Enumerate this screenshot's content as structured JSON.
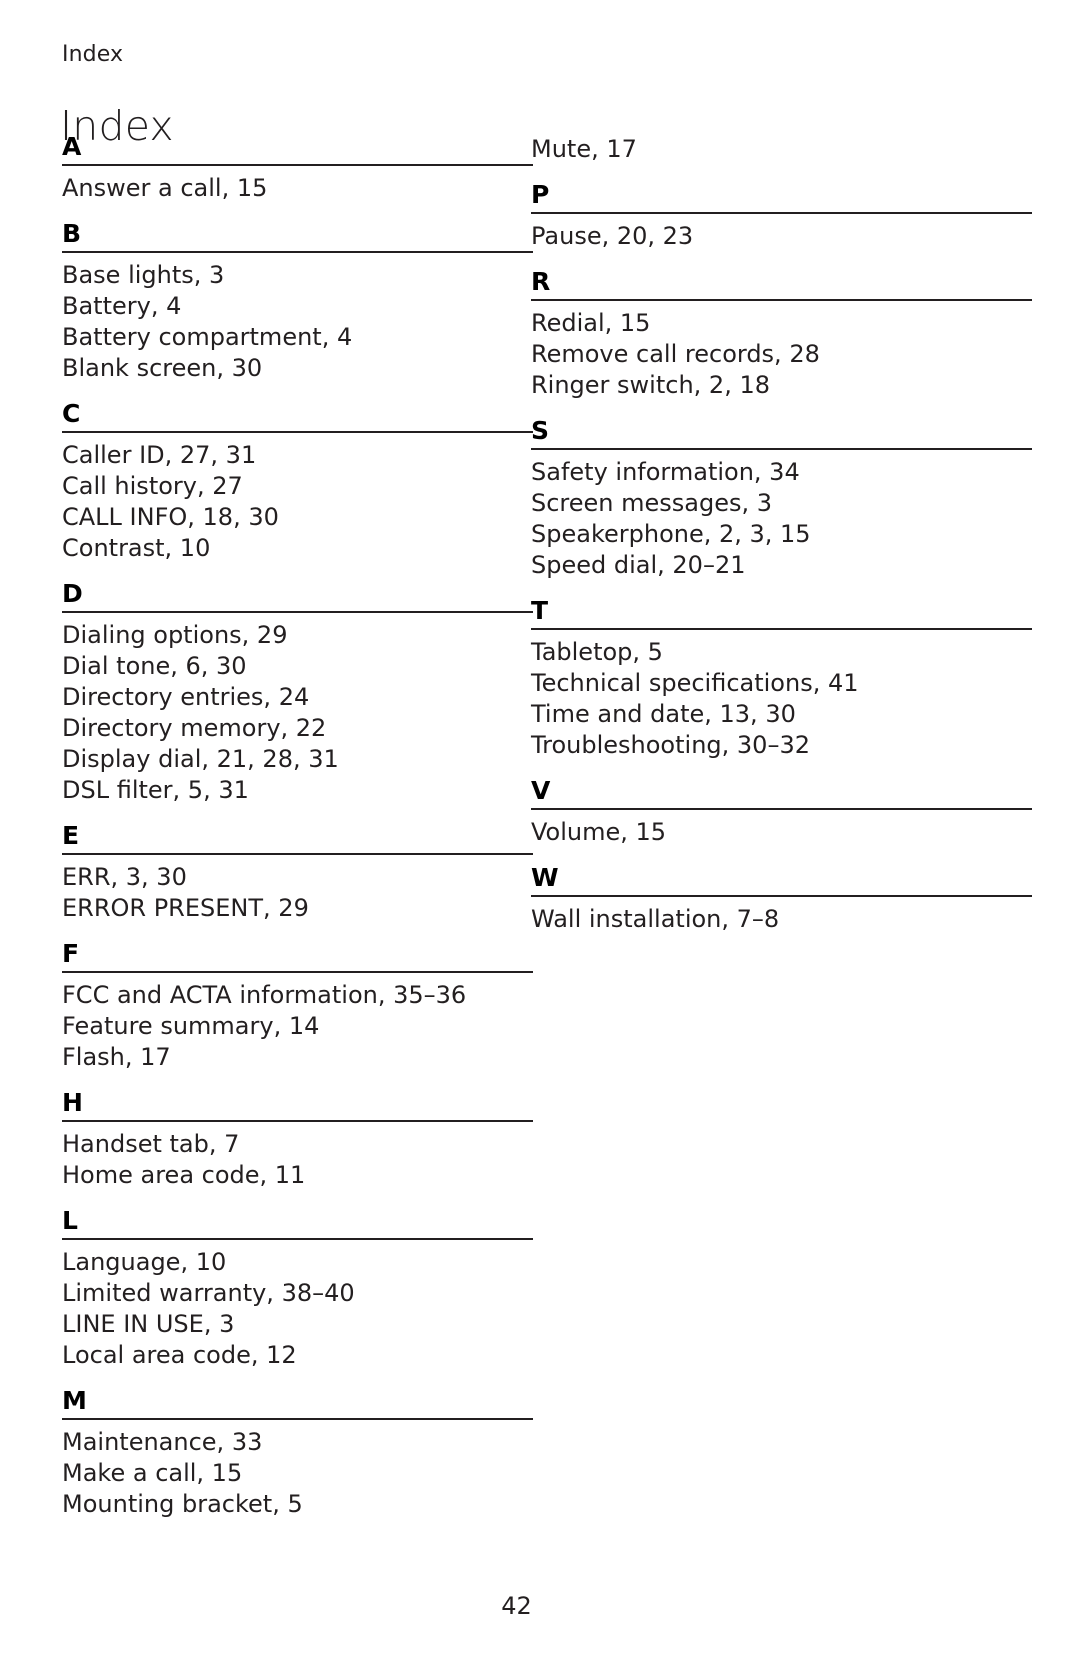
{
  "document": {
    "running_header": "Index",
    "title": "Index",
    "page_number": "42",
    "rule_color": "#231f20",
    "text_color": "#231f20"
  },
  "columns": [
    {
      "name": "left-column",
      "continuation_entries": [],
      "groups": [
        {
          "letter": "A",
          "entries": [
            "Answer a call, 15"
          ]
        },
        {
          "letter": "B",
          "entries": [
            "Base lights, 3",
            "Battery, 4",
            "Battery compartment, 4",
            "Blank screen, 30"
          ]
        },
        {
          "letter": "C",
          "entries": [
            "Caller ID, 27, 31",
            "Call history, 27",
            "CALL INFO, 18, 30",
            "Contrast, 10"
          ]
        },
        {
          "letter": "D",
          "entries": [
            "Dialing options, 29",
            "Dial tone, 6, 30",
            "Directory entries, 24",
            "Directory memory, 22",
            "Display dial, 21, 28, 31",
            "DSL filter, 5, 31"
          ]
        },
        {
          "letter": "E",
          "entries": [
            "ERR, 3, 30",
            "ERROR PRESENT, 29"
          ]
        },
        {
          "letter": "F",
          "entries": [
            "FCC and ACTA information, 35–36",
            "Feature summary, 14",
            "Flash, 17"
          ]
        },
        {
          "letter": "H",
          "entries": [
            "Handset tab, 7",
            "Home area code, 11"
          ]
        },
        {
          "letter": "L",
          "entries": [
            "Language, 10",
            "Limited warranty, 38–40",
            "LINE IN USE, 3",
            "Local area code, 12"
          ]
        },
        {
          "letter": "M",
          "entries": [
            "Maintenance, 33",
            "Make a call, 15",
            "Mounting bracket, 5"
          ]
        }
      ]
    },
    {
      "name": "right-column",
      "continuation_entries": [
        "Mute, 17"
      ],
      "groups": [
        {
          "letter": "P",
          "entries": [
            "Pause, 20, 23"
          ]
        },
        {
          "letter": "R",
          "entries": [
            "Redial, 15",
            "Remove call records, 28",
            "Ringer switch, 2, 18"
          ]
        },
        {
          "letter": "S",
          "entries": [
            "Safety information, 34",
            "Screen messages, 3",
            "Speakerphone, 2, 3, 15",
            "Speed dial, 20–21"
          ]
        },
        {
          "letter": "T",
          "entries": [
            "Tabletop, 5",
            "Technical specifications, 41",
            "Time and date, 13, 30",
            "Troubleshooting, 30–32"
          ]
        },
        {
          "letter": "V",
          "entries": [
            "Volume, 15"
          ]
        },
        {
          "letter": "W",
          "entries": [
            "Wall installation, 7–8"
          ]
        }
      ]
    }
  ]
}
